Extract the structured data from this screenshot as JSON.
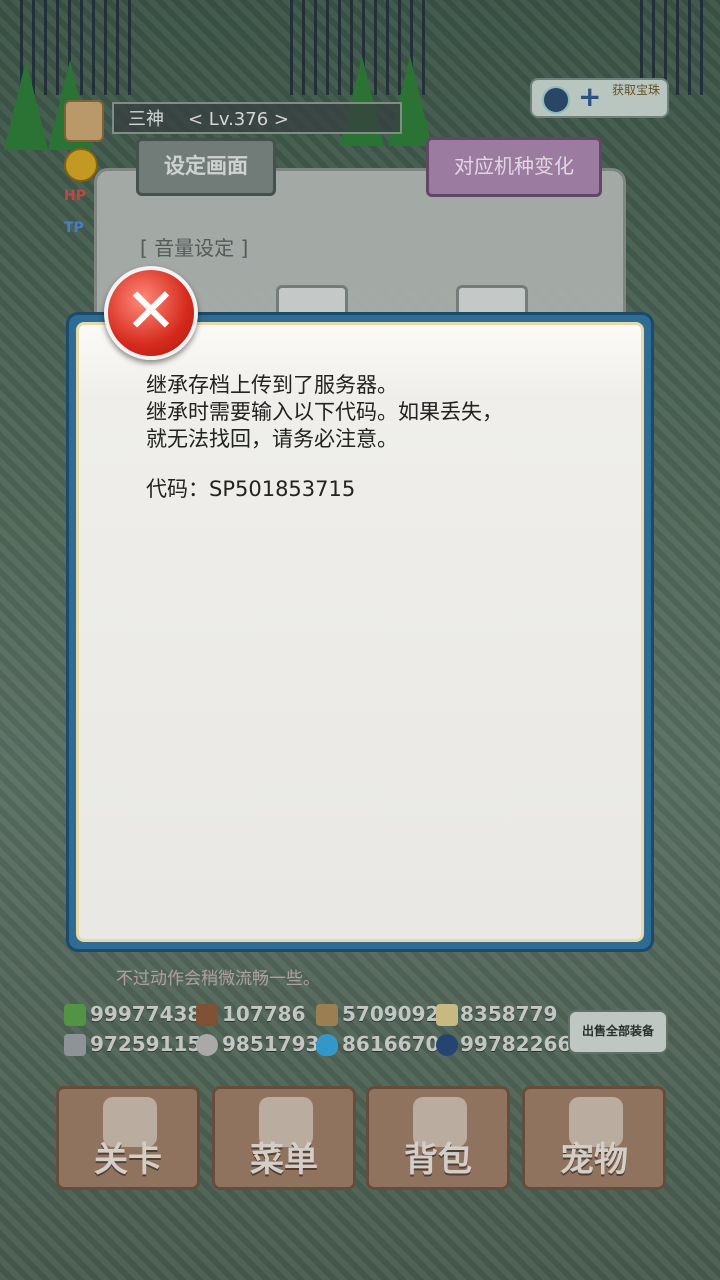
{
  "header": {
    "player_name": "三神",
    "level": "< Lv.376 >",
    "hp_label": "HP",
    "tp_label": "TP"
  },
  "top_right": {
    "label": "获取宝珠"
  },
  "settings": {
    "title": "设定画面",
    "device_button": "对应机种变化",
    "volume_label": "[ 音量设定 ]"
  },
  "dialog": {
    "lines": [
      "继承存档上传到了服务器。",
      "继承时需要输入以下代码。如果丢失，",
      "就无法找回，请务必注意。"
    ],
    "code_label": "代码：",
    "code_value": "SP501853715"
  },
  "hint_text": "不过动作会稍微流畅一些。",
  "resources": {
    "row1": [
      "99977438",
      "107786",
      "5709092",
      "8358779"
    ],
    "row2": [
      "97259115",
      "9851793",
      "8616670",
      "99782266"
    ]
  },
  "sell_button": "出售全部装备",
  "nav": [
    "关卡",
    "菜单",
    "背包",
    "宠物"
  ],
  "colors": {
    "dialog_border": "#2f6c93",
    "close_button": "#d52a1c",
    "device_button": "#a986ad"
  }
}
